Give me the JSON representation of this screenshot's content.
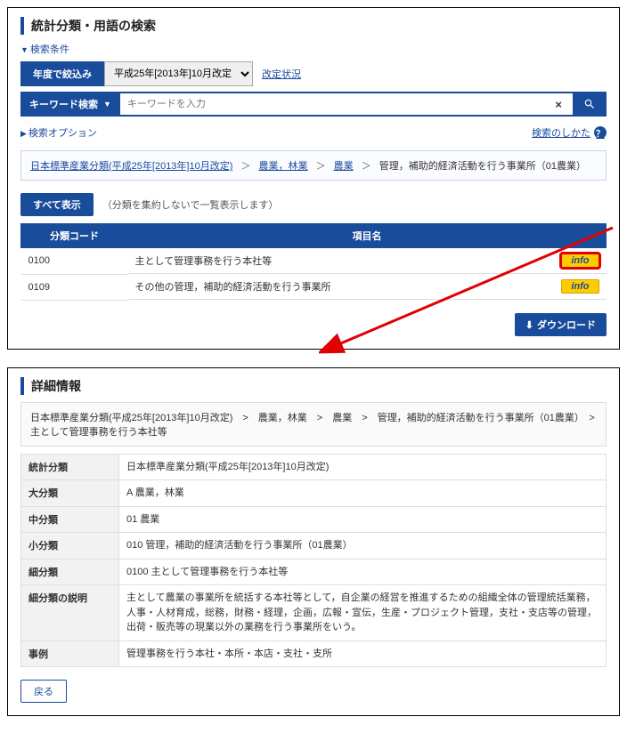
{
  "top": {
    "title": "統計分類・用語の検索",
    "conditions_label": "検索条件",
    "year_filter_btn": "年度で絞込み",
    "year_select_value": "平成25年[2013年]10月改定",
    "revision_link": "改定状況",
    "keyword_btn": "キーワード検索",
    "keyword_placeholder": "キーワードを入力",
    "search_options": "検索オプション",
    "howto": "検索のしかた",
    "q_icon": "？",
    "breadcrumb": {
      "a": "日本標準産業分類(平成25年[2013年]10月改定)",
      "b": "農業，林業",
      "c": "農業",
      "d": "管理，補助的経済活動を行う事業所（01農業）"
    },
    "show_all": "すべて表示",
    "show_all_note": "（分類を集約しないで一覧表示します）",
    "table": {
      "col_code": "分類コード",
      "col_name": "項目名",
      "rows": [
        {
          "code": "0100",
          "name": "主として管理事務を行う本社等",
          "info": "info"
        },
        {
          "code": "0109",
          "name": "その他の管理，補助的経済活動を行う事業所",
          "info": "info"
        }
      ]
    },
    "download": "ダウンロード"
  },
  "detail": {
    "title": "詳細情報",
    "breadcrumb": "日本標準産業分類(平成25年[2013年]10月改定)　>　農業，林業　>　農業　>　管理，補助的経済活動を行う事業所（01農業）　>　主として管理事務を行う本社等",
    "rows": [
      {
        "label": "統計分類",
        "value": "日本標準産業分類(平成25年[2013年]10月改定)"
      },
      {
        "label": "大分類",
        "value": "A 農業，林業"
      },
      {
        "label": "中分類",
        "value": "01 農業"
      },
      {
        "label": "小分類",
        "value": "010 管理，補助的経済活動を行う事業所（01農業）"
      },
      {
        "label": "細分類",
        "value": "0100 主として管理事務を行う本社等"
      },
      {
        "label": "細分類の説明",
        "value": "主として農業の事業所を統括する本社等として，自企業の経営を推進するための組織全体の管理統括業務，人事・人材育成，総務，財務・経理，企画，広報・宣伝，生産・プロジェクト管理，支社・支店等の管理，出荷・販売等の現業以外の業務を行う事業所をいう。"
      },
      {
        "label": "事例",
        "value": "管理事務を行う本社・本所・本店・支社・支所"
      }
    ],
    "back": "戻る"
  }
}
